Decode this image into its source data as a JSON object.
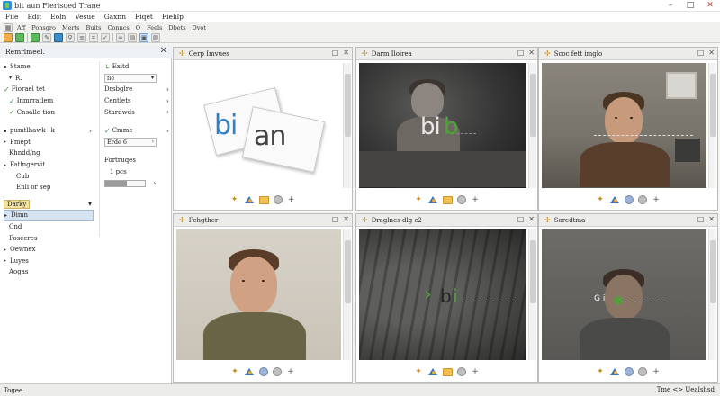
{
  "window": {
    "title": "bit aun Fierisoed Trane",
    "min": "–",
    "max": "□",
    "close": "✕"
  },
  "menu": [
    "File",
    "Edit",
    "Eoln",
    "Vesue",
    "Gaxnn",
    "Fiqet",
    "Fiehlp"
  ],
  "toolbar": {
    "row1": [
      "Aff",
      "Ponsgro",
      "Merts",
      "Buits",
      "Conncs",
      "O",
      "Feels",
      "Dbets",
      "Dvot"
    ],
    "icons": [
      "refresh-icon",
      "folder-icon",
      "chart-icon",
      "pen-icon",
      "move-icon",
      "zoom-icon",
      "grid-icon",
      "layers-icon",
      "crop-icon",
      "check-icon",
      "link-icon",
      "doc-icon",
      "panel-icon",
      "view-icon"
    ]
  },
  "sidebar": {
    "header": "Remrlmeel.",
    "left": {
      "r1": "Stame",
      "r2": "R.",
      "r3": "Fiorael tet",
      "r4": "Inmrratlem",
      "r5": "Cnsallo tion",
      "r6": "pumtlhawk",
      "r6b": "k",
      "r7": "Fmept",
      "r8": "Khndd/ng",
      "r9": "Fatlngervit",
      "r10": "Cub",
      "r11": "Enli or sep",
      "r12": "Darky",
      "r13": "Dimn",
      "r14": "Cnd",
      "r15": "Fosecres",
      "r16": "Oewnex",
      "r17": "Luyes",
      "r18": "Aogas"
    },
    "right": {
      "r1": "Exitd",
      "r2": "fle",
      "r3": "Drsbglre",
      "r4": "Centlets",
      "r5": "Stardwds",
      "r6": "Cmme",
      "r7": "Erde 6",
      "r8": "Fortruqes",
      "r9": "1 pcs",
      "slider": 0.55
    }
  },
  "panels": [
    {
      "title": "Cerp Imvues",
      "kind": "logo",
      "logo_blue": "bi",
      "logo_dark": "an"
    },
    {
      "title": "Darm Iloirea",
      "kind": "baby-logo",
      "logo_blue": "bi",
      "logo_green": "b"
    },
    {
      "title": "Scoc fett imglo",
      "kind": "portrait-office"
    },
    {
      "title": "Fchgther",
      "kind": "portrait-wall"
    },
    {
      "title": "Draglnes dlg c2",
      "kind": "keyboard",
      "overlay_dark": "b",
      "overlay_green": "i"
    },
    {
      "title": "Soredtma",
      "kind": "portrait-dim",
      "marker": "G i"
    }
  ],
  "status": {
    "left": "Togee",
    "right": "Tme <> Uealshsd"
  },
  "colors": {
    "accent_blue": "#2f7fc6",
    "accent_green": "#4da23a",
    "accent_orange": "#e8a838"
  }
}
